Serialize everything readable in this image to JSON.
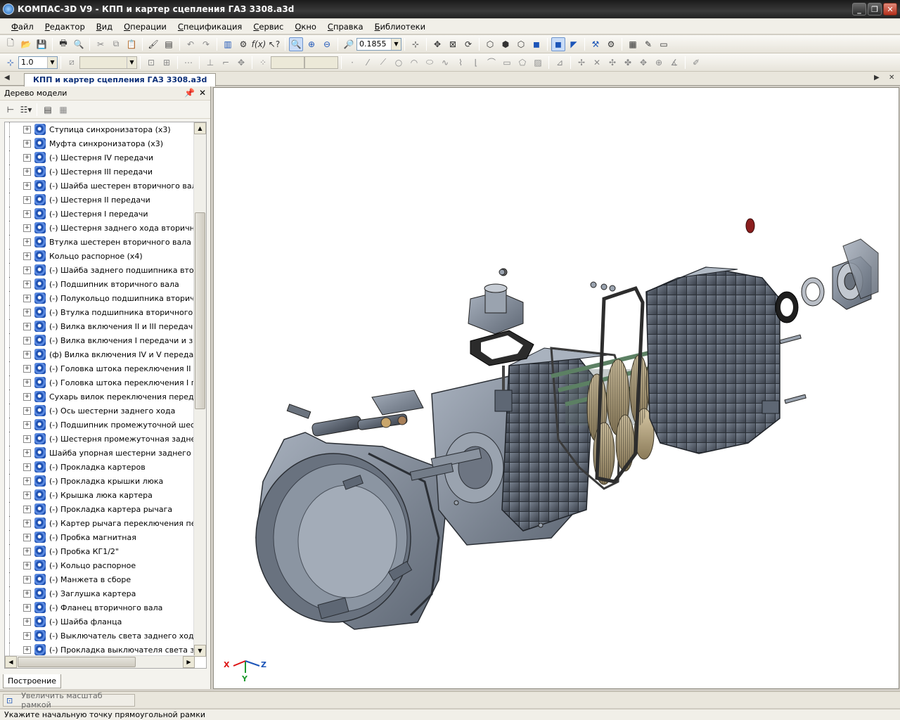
{
  "window": {
    "title": "КОМПАС-3D V9 - КПП и картер сцепления ГАЗ 3308.a3d",
    "controls": [
      "_",
      "❐",
      "✕"
    ]
  },
  "menu": [
    "Файл",
    "Редактор",
    "Вид",
    "Операции",
    "Спецификация",
    "Сервис",
    "Окно",
    "Справка",
    "Библиотеки"
  ],
  "toolbar": {
    "zoom_value": "0.1855",
    "step_value": "1.0"
  },
  "document": {
    "tab_label": "КПП и картер сцепления ГАЗ 3308.a3d"
  },
  "tree_panel": {
    "title": "Дерево модели",
    "bottom_tab": "Построение",
    "items": [
      "Ступица синхронизатора (x3)",
      "Муфта синхронизатора (x3)",
      "(-) Шестерня IV передачи",
      "(-) Шестерня III передачи",
      "(-) Шайба шестерен вторичного вала",
      "(-) Шестерня II передачи",
      "(-) Шестерня I передачи",
      "(-) Шестерня заднего хода вторичного",
      "Втулка шестерен вторичного вала (x3",
      "Кольцо распорное (x4)",
      "(-) Шайба заднего подшипника вторич",
      "(-) Подшипник вторичного вала",
      "(-) Полукольцо подшипника вторично",
      "(-) Втулка подшипника вторичного вал",
      "(-) Вилка включения II и III передач",
      "(-) Вилка включения I передачи и зад",
      "(ф) Вилка включения IV и V передач",
      "(-) Головка штока переключения II и I",
      "(-) Головка штока переключения I пер",
      "Сухарь вилок переключения передач",
      "(-) Ось шестерни заднего хода",
      "(-) Подшипник промежуточной шестер",
      "(-) Шестерня промежуточная заднего",
      "Шайба упорная шестерни заднего ход",
      "(-) Прокладка картеров",
      "(-) Прокладка крышки люка",
      "(-) Крышка люка картера",
      "(-) Прокладка картера рычага",
      "(-) Картер рычага переключения пере",
      "(-) Пробка магнитная",
      "(-) Пробка КГ1/2\"",
      "(-) Кольцо распорное",
      "(-) Манжета в сборе",
      "(-) Заглушка картера",
      "(-) Фланец вторичного вала",
      "(-) Шайба фланца",
      "(-) Выключатель света заднего хода",
      "(-) Прокладка выключателя света зад"
    ]
  },
  "axes": {
    "x": "X",
    "y": "Y",
    "z": "Z"
  },
  "command": {
    "current": "Увеличить масштаб рамкой"
  },
  "status": {
    "prompt": "Укажите начальную точку прямоугольной рамки"
  },
  "colors": {
    "model_body": "#7d8795",
    "model_dark": "#3b414b",
    "gear": "#b9a57f",
    "gasket": "#5a5a5a",
    "tree_icon": "#1d4fb0",
    "plug_red": "#8b1e1e"
  }
}
